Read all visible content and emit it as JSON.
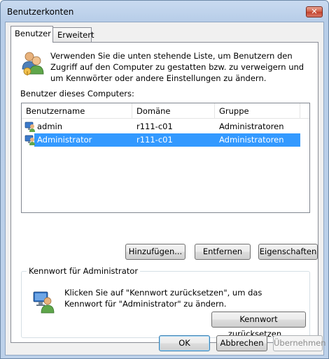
{
  "window": {
    "title": "Benutzerkonten",
    "close_glyph": "✕"
  },
  "tabs": [
    {
      "label": "Benutzer",
      "active": true
    },
    {
      "label": "Erweitert",
      "active": false
    }
  ],
  "intro": {
    "icon": "users-icon",
    "text": "Verwenden Sie die unten stehende Liste, um Benutzern den Zugriff auf den Computer zu gestatten bzw. zu verweigern und um Kennwörter oder andere Einstellungen zu ändern."
  },
  "users_label": "Benutzer dieses Computers:",
  "users_table": {
    "columns": [
      "Benutzername",
      "Domäne",
      "Gruppe"
    ],
    "rows": [
      {
        "name": "admin",
        "domain": "r111-c01",
        "group": "Administratoren",
        "selected": false
      },
      {
        "name": "Administrator",
        "domain": "r111-c01",
        "group": "Administratoren",
        "selected": true
      }
    ]
  },
  "user_buttons": {
    "add": "Hinzufügen...",
    "remove": "Entfernen",
    "properties": "Eigenschaften"
  },
  "password_group": {
    "legend": "Kennwort für Administrator",
    "text": "Klicken Sie auf \"Kennwort zurücksetzen\", um das Kennwort für \"Administrator\" zu ändern.",
    "reset_button": "Kennwort zurücksetzen..."
  },
  "dialog_buttons": {
    "ok": "OK",
    "cancel": "Abbrechen",
    "apply": "Übernehmen"
  },
  "colors": {
    "selection": "#3399ff",
    "title_bar": "#c9daf0"
  }
}
